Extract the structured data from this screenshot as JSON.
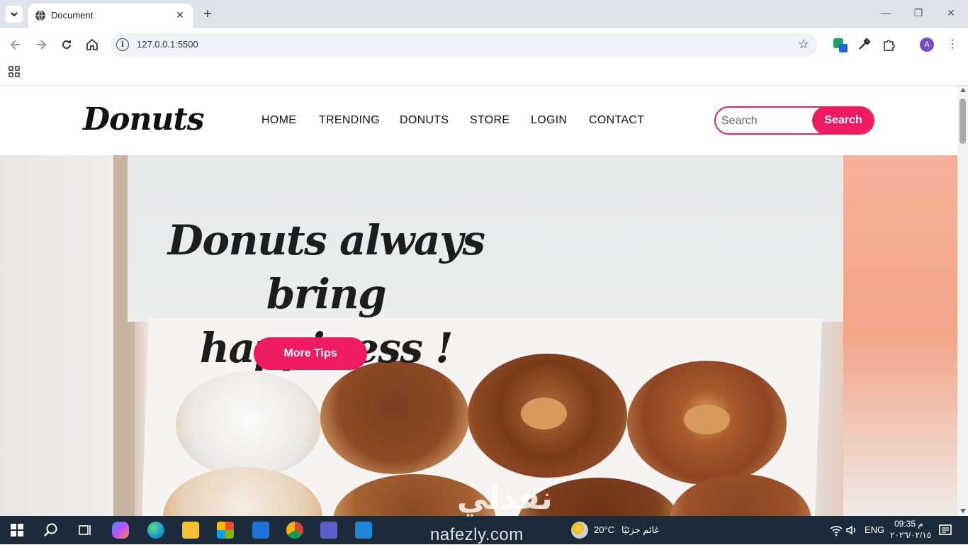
{
  "browser": {
    "tab_title": "Document",
    "tab_close": "✕",
    "new_tab": "+",
    "url": "127.0.0.1:5500",
    "info_glyph": "i",
    "avatar_letter": "A",
    "menu_glyph": "⋮",
    "bookmark_glyph": "☆",
    "window_controls": {
      "minimize": "—",
      "restore": "❐",
      "close": "✕"
    }
  },
  "site": {
    "logo": "Donuts",
    "nav": [
      "HOME",
      "TRENDING",
      "DONUTS",
      "STORE",
      "LOGIN",
      "CONTACT"
    ],
    "search": {
      "placeholder": "Search",
      "button": "Search"
    },
    "hero": {
      "title_line1": "Donuts always bring",
      "title_line2": "happiness !",
      "button": "More Tips"
    },
    "accent_color": "#ef1b62"
  },
  "taskbar": {
    "watermark_latin": "nafezly.com",
    "watermark_arabic": "نفذلي",
    "weather": "20°C",
    "weather_desc": "غائم جزئيًا",
    "language": "ENG",
    "time": "09:35 م",
    "date": "٢٠٢٦/٠٢/١٥"
  },
  "icons": [
    "tab-list-icon",
    "globe-icon",
    "back-icon",
    "forward-icon",
    "reload-icon",
    "home-icon",
    "info-icon",
    "star-icon",
    "extension-icon",
    "eyedropper-icon",
    "puzzle-icon",
    "apps-grid-icon",
    "windows-start-icon",
    "search-icon",
    "task-view-icon",
    "copilot-icon",
    "edge-icon",
    "file-explorer-icon",
    "store-icon",
    "outlook-icon",
    "chrome-icon",
    "teams-icon",
    "vscode-icon",
    "weather-icon",
    "wifi-icon",
    "volume-icon",
    "notification-icon"
  ]
}
